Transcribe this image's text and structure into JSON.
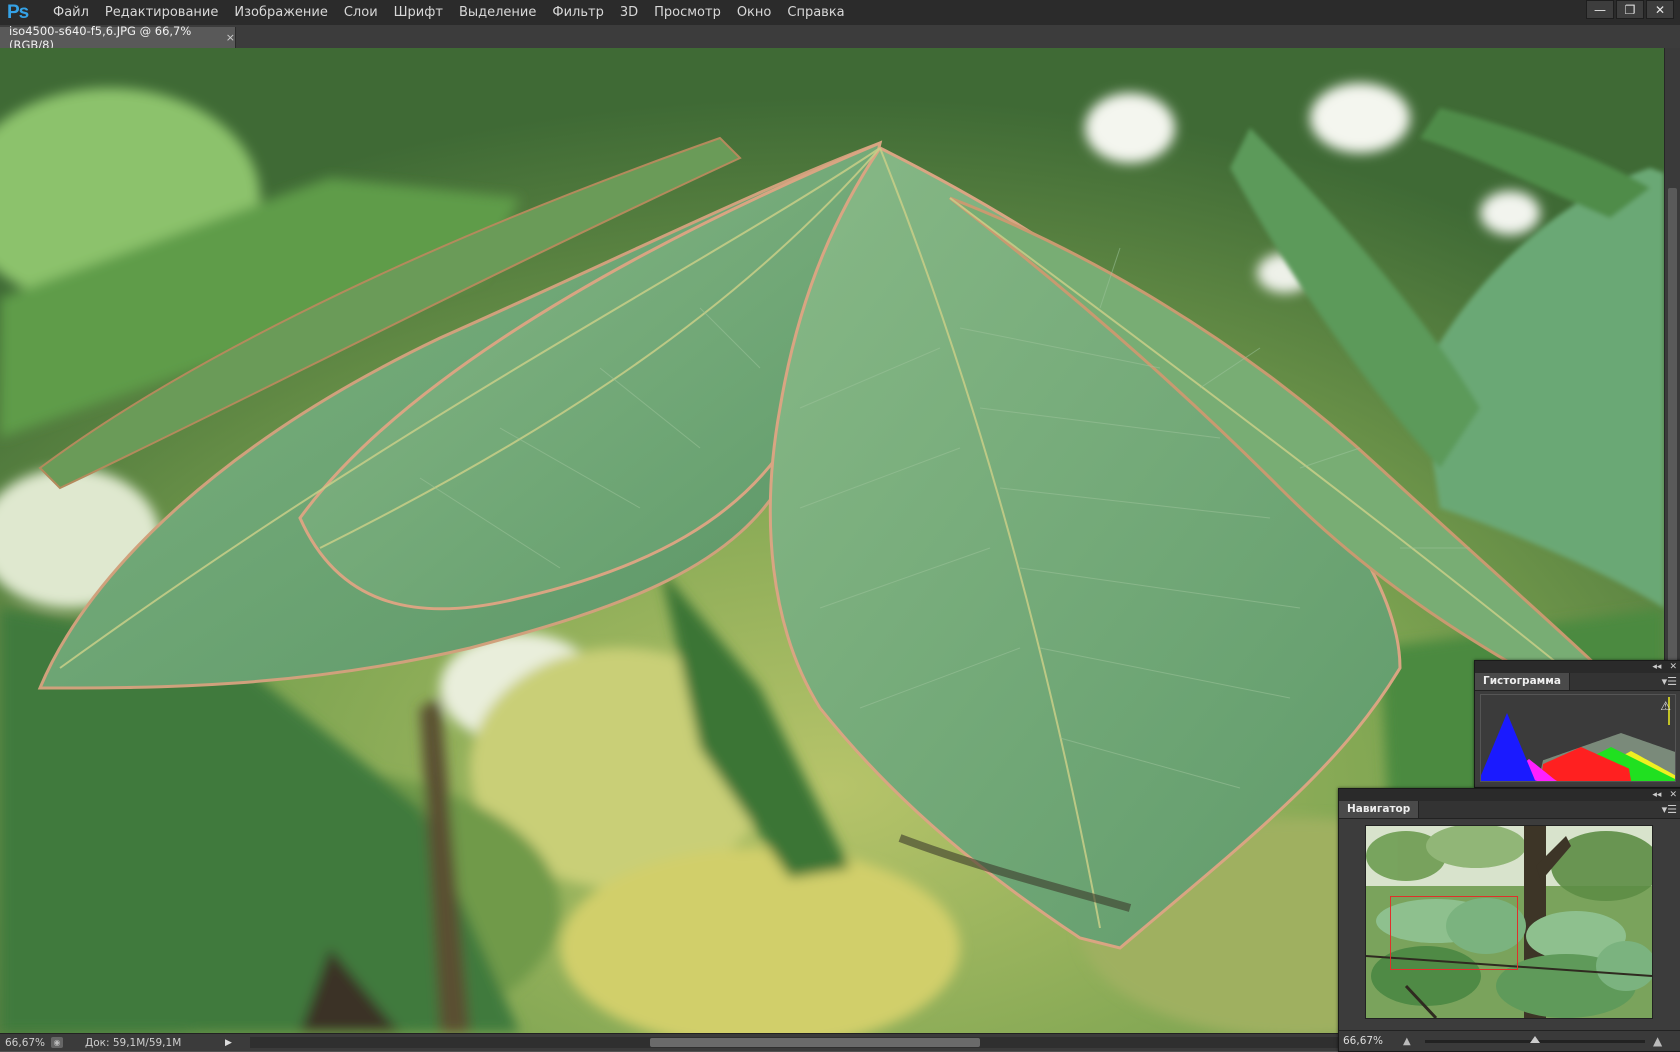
{
  "app": {
    "logo": "Ps",
    "menu": [
      "Файл",
      "Редактирование",
      "Изображение",
      "Слои",
      "Шрифт",
      "Выделение",
      "Фильтр",
      "3D",
      "Просмотр",
      "Окно",
      "Справка"
    ],
    "window_controls": {
      "minimize": "—",
      "restore": "❐",
      "close": "✕"
    }
  },
  "document": {
    "tab_title": "iso4500-s640-f5,6.JPG @ 66,7% (RGB/8)",
    "tab_close": "×"
  },
  "status": {
    "zoom": "66,67%",
    "doc_info": "Док: 59,1M/59,1M",
    "arrow": "▶"
  },
  "panels": {
    "histogram": {
      "tab": "Гистограмма",
      "collapse": "◂◂",
      "close": "✕",
      "menu": "▾☰",
      "warning_icon": "⚠"
    },
    "navigator": {
      "tab": "Навигатор",
      "collapse": "◂◂",
      "close": "✕",
      "menu": "▾☰",
      "zoom": "66,67%",
      "zoom_out": "▲",
      "zoom_in": "▲",
      "slider_value": 0.5
    }
  },
  "colors": {
    "menubar_bg": "#2b2b2b",
    "ps_blue": "#35a2e6",
    "nav_rect": "#e0302a",
    "hist_blue": "#1a1aff",
    "hist_red": "#ff2020",
    "hist_green": "#20e020",
    "hist_yellow": "#f0f020",
    "hist_magenta": "#ff20ff"
  }
}
